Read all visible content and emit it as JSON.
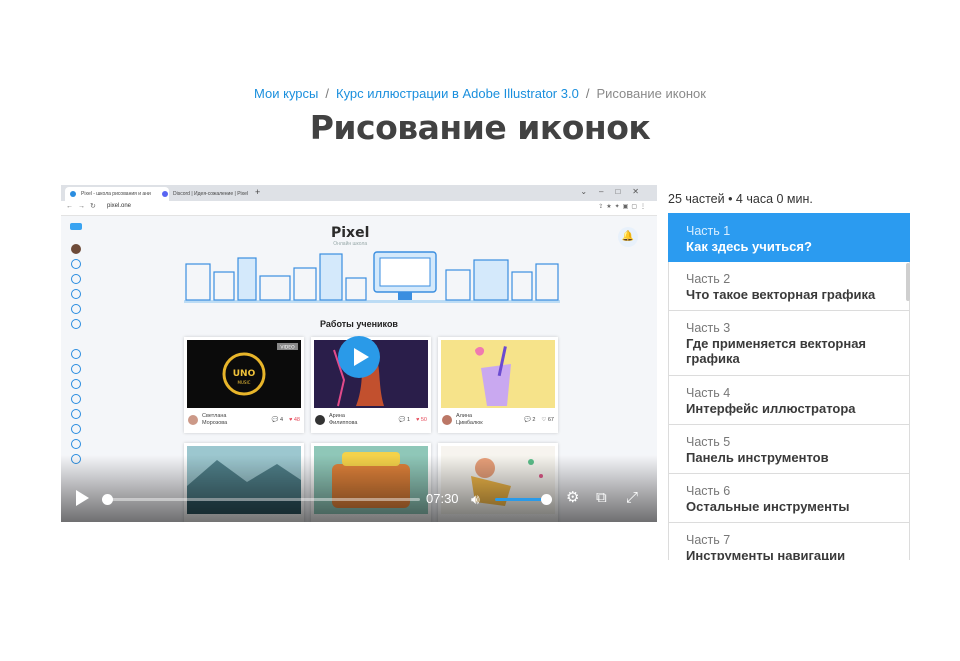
{
  "breadcrumbs": {
    "item1": "Мои курсы",
    "item2": "Курс иллюстрации в Adobe Illustrator 3.0",
    "current": "Рисование иконок",
    "separator": "/"
  },
  "page_title": "Рисование иконок",
  "video": {
    "browser_tabs": [
      "Pixel - школа рисования и ани",
      "Discord | Идея-сожаление | Pixel"
    ],
    "url": "pixel.one",
    "site_brand": "Pixel",
    "site_tagline": "Онлайн школа",
    "section_title": "Работы учеников",
    "cards": [
      {
        "author_line1": "Светлана",
        "author_line2": "Морозова",
        "comments": "4",
        "likes": "48",
        "badge": "VIDEO"
      },
      {
        "author_line1": "Арина",
        "author_line2": "Филиппова",
        "comments": "1",
        "likes": "50"
      },
      {
        "author_line1": "Алина",
        "author_line2": "Цимбалюк",
        "comments": "2",
        "likes": "67"
      }
    ],
    "thumb_text": "UNO MUSIC",
    "time": "07:30",
    "progress_fraction": 0.02,
    "volume_fraction": 1.0
  },
  "lessons": {
    "summary": "25 частей • 4 часа 0 мин.",
    "items": [
      {
        "part": "Часть 1",
        "title": "Как здесь учиться?"
      },
      {
        "part": "Часть 2",
        "title": "Что такое векторная графика"
      },
      {
        "part": "Часть 3",
        "title": "Где применяется векторная графика"
      },
      {
        "part": "Часть 4",
        "title": "Интерфейс иллюстратора"
      },
      {
        "part": "Часть 5",
        "title": "Панель инструментов"
      },
      {
        "part": "Часть 6",
        "title": "Остальные инструменты"
      },
      {
        "part": "Часть 7",
        "title": "Инструменты навигации"
      }
    ]
  },
  "colors": {
    "accent": "#2b9bf0",
    "link": "#1a8fdd",
    "title": "#424242"
  }
}
